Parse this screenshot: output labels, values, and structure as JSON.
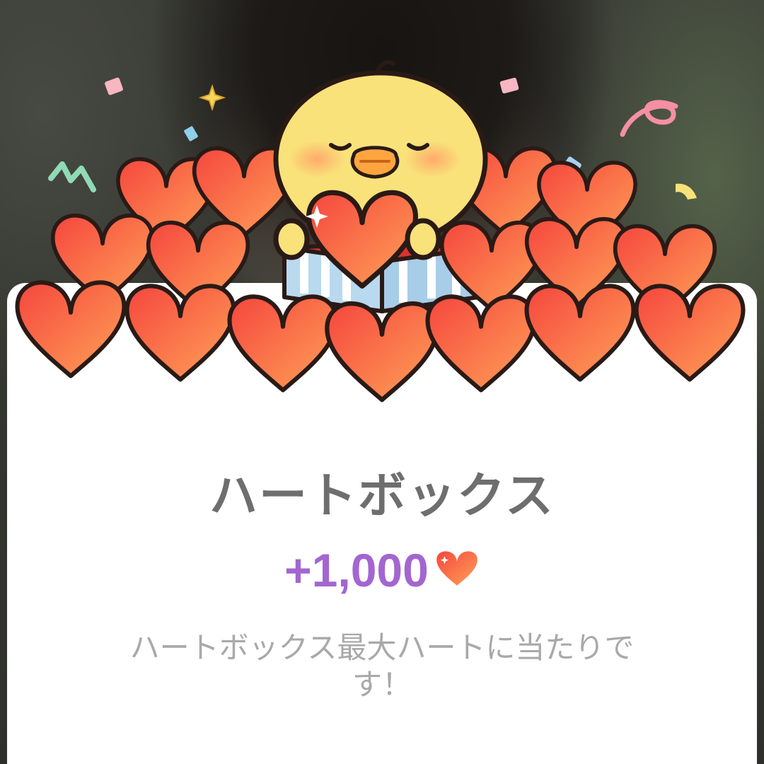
{
  "dialog": {
    "title": "ハートボックス",
    "reward_amount": "+1,000",
    "reward_icon": "heart-icon",
    "message": "ハートボックス最大ハートに当たりです！"
  },
  "colors": {
    "title": "#6e6e6e",
    "reward_amount": "#a366d1",
    "message": "#a9a9a9",
    "heart_light": "#ff9a55",
    "heart_dark": "#f5463e",
    "chick": "#f9e27a"
  },
  "illustration": {
    "name": "chick-holding-heart-with-heart-pile",
    "decorations": [
      "confetti",
      "sparkle"
    ]
  }
}
